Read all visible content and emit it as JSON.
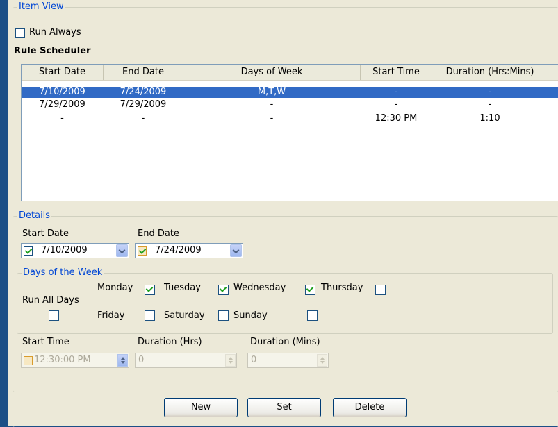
{
  "item_view": {
    "legend": "Item View",
    "run_always_label": "Run Always",
    "rule_scheduler_title": "Rule Scheduler"
  },
  "table": {
    "headers": [
      "Start Date",
      "End Date",
      "Days of Week",
      "Start Time",
      "Duration (Hrs:Mins)"
    ],
    "rows": [
      {
        "start_date": "7/10/2009",
        "end_date": "7/24/2009",
        "days": "M,T,W",
        "start_time": "-",
        "duration": "-",
        "selected": true
      },
      {
        "start_date": "7/29/2009",
        "end_date": "7/29/2009",
        "days": "-",
        "start_time": "-",
        "duration": "-",
        "selected": false
      },
      {
        "start_date": "-",
        "end_date": "-",
        "days": "-",
        "start_time": "12:30 PM",
        "duration": "1:10",
        "selected": false
      }
    ]
  },
  "details": {
    "legend": "Details",
    "start_date_label": "Start Date",
    "end_date_label": "End Date",
    "start_date_value": "7/10/2009",
    "end_date_value": "7/24/2009",
    "start_date_checked": true,
    "end_date_checked": true
  },
  "days_of_week": {
    "legend": "Days of the Week",
    "run_all_days_label": "Run All Days",
    "run_all_days_checked": false,
    "monday": {
      "label": "Monday",
      "checked": true
    },
    "tuesday": {
      "label": "Tuesday",
      "checked": true
    },
    "wednesday": {
      "label": "Wednesday",
      "checked": true
    },
    "thursday": {
      "label": "Thursday",
      "checked": false
    },
    "friday": {
      "label": "Friday",
      "checked": false
    },
    "saturday": {
      "label": "Saturday",
      "checked": false
    },
    "sunday": {
      "label": "Sunday",
      "checked": false
    }
  },
  "time": {
    "start_time_label": "Start Time",
    "start_time_value": "12:30:00 PM",
    "duration_hrs_label": "Duration (Hrs)",
    "duration_hrs_value": "0",
    "duration_mins_label": "Duration (Mins)",
    "duration_mins_value": "0"
  },
  "buttons": {
    "new_label": "New",
    "set_label": "Set",
    "delete_label": "Delete"
  },
  "colors": {
    "accent": "#0046d5",
    "selection": "#316ac5",
    "background": "#ece9d8",
    "frame": "#1c4f86"
  }
}
